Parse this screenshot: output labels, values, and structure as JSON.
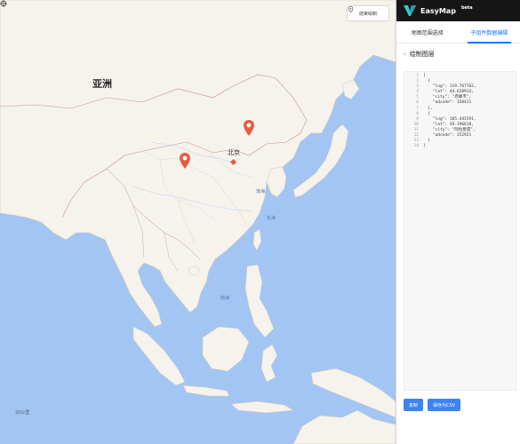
{
  "map": {
    "region_label": "亚洲",
    "city_label": "北京",
    "sea_labels": {
      "bohai": "渤海",
      "east": "东海",
      "south": "南海"
    },
    "scale_text": "20公里",
    "draw_button_label": "结束绘制"
  },
  "panel": {
    "brand": "EasyMap",
    "beta": "beta",
    "tabs": [
      {
        "label": "地图范围选择",
        "active": false
      },
      {
        "label": "子组件数据编辑",
        "active": true
      }
    ],
    "section_title": "绘制图层",
    "code_lines": [
      "[",
      "  {",
      "    \"lng\": 119.767762,",
      "    \"lat\": 44.620914,",
      "    \"city\": \"赤峰市\",",
      "    \"adcode\": 150421",
      "  },",
      "  {",
      "    \"lng\": 105.441591,",
      "    \"lat\": 39.196618,",
      "    \"city\": \"阿拉善盟\",",
      "    \"adcode\": 152921",
      "  }",
      "]"
    ],
    "line_numbers": [
      "1",
      "2",
      "3",
      "4",
      "5",
      "6",
      "7",
      "8",
      "9",
      "10",
      "11",
      "12",
      "13",
      "14"
    ],
    "copy_button": "复制",
    "save_button": "保存为CSV"
  },
  "colors": {
    "accent": "#1677ff",
    "button": "#3c83f5",
    "topbar": "#161616",
    "pin": "#e45d43",
    "water": "#a3c5f4",
    "land": "#f6f3ec"
  }
}
